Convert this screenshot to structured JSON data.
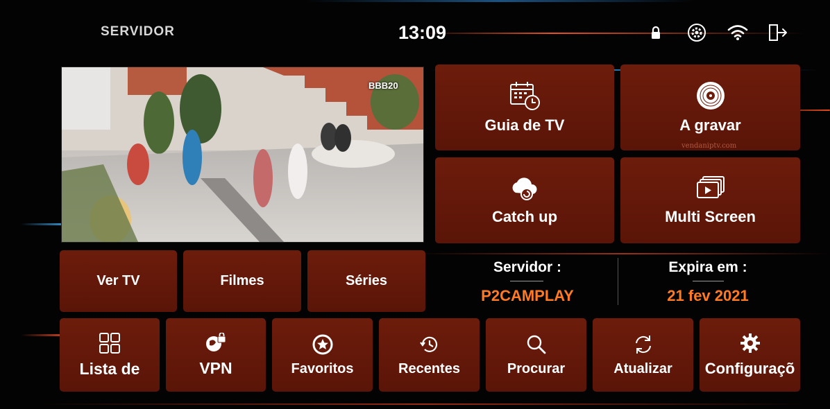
{
  "header": {
    "brand": "SERVIDOR",
    "time": "13:09",
    "icons": [
      "lock-icon",
      "settings-refresh-icon",
      "wifi-icon",
      "exit-icon"
    ]
  },
  "video": {
    "channel_logo": "BBB20",
    "watermark": "vendaniptv.com"
  },
  "main_tiles": {
    "guide": "Guia de TV",
    "recording": "A gravar",
    "catchup": "Catch up",
    "multiscreen": "Multi Screen"
  },
  "category_tiles": {
    "tv": "Ver TV",
    "movies": "Filmes",
    "series": "Séries"
  },
  "info": {
    "server_label": "Servidor :",
    "server_value": "P2CAMPLAY",
    "expiry_label": "Expira em :",
    "expiry_value": "21 fev 2021"
  },
  "bottom_bar": {
    "list": "Lista de",
    "vpn": "VPN",
    "favorites": "Favoritos",
    "recent": "Recentes",
    "search": "Procurar",
    "update": "Atualizar",
    "settings": "Configuraçõ"
  },
  "colors": {
    "tile": "#6d1c0b",
    "accent": "#ff7a22",
    "background": "#030303"
  }
}
